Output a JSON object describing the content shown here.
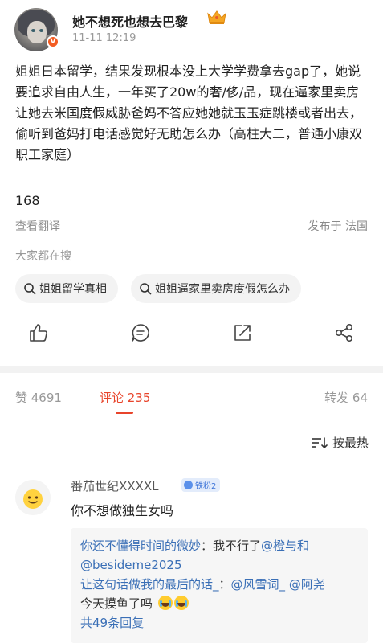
{
  "post": {
    "username": "她不想死也想去巴黎",
    "time": "11-11 12:19",
    "body": "姐姐日本留学，结果发现根本没上大学学费拿去gap了，她说要追求自由人生，一年买了20w的奢/侈/品，现在逼家里卖房让她去米国度假威胁爸妈不答应她她就玉玉症跳楼或者出去，偷听到爸妈打电话感觉好无助怎么办（高柱大二，普通小康双职工家庭）",
    "count": "168",
    "translate_label": "查看翻译",
    "publish_location": "发布于 法国"
  },
  "search": {
    "title": "大家都在搜",
    "chips": [
      "姐姐留学真相",
      "姐姐逼家里卖房度假怎么办"
    ]
  },
  "stats": {
    "likes": "赞 4691",
    "comments": "评论 235",
    "reposts": "转发 64"
  },
  "sort_label": "按最热",
  "comment": {
    "name": "番茄世纪XXXXL",
    "badge": "铁粉2",
    "text": "你不想做独生女吗"
  },
  "replies": {
    "r1_name": "你还不懂得时间的微妙",
    "r1_text": "：我不行了",
    "r1_mention1": "@橙与和",
    "r1_mention2": "@besideme2025",
    "r2_name": "让这句话做我的最后的话_",
    "r2_text": "：",
    "r2_mention1": "@风雪词_",
    "r2_mention2": "@阿尧",
    "r2_tail": "今天摸鱼了吗",
    "more": "共49条回复"
  },
  "colors": {
    "accent": "#e8442b",
    "link": "#3a6fb6",
    "muted": "#999999"
  }
}
